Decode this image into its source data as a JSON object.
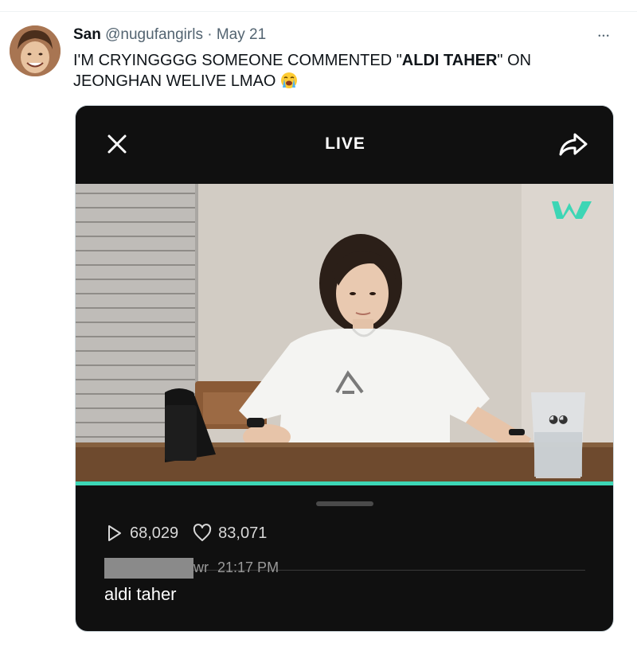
{
  "tweet": {
    "author_name": "San",
    "author_handle": "@nugufangirls",
    "separator": "·",
    "date": "May 21",
    "more_label": "•••",
    "text_part1": "I'M CRYINGGGG SOMEONE COMMENTED \"",
    "text_bold": "ALDI TAHER",
    "text_part2": "\" ON JEONGHAN WELIVE LMAO",
    "emoji_icon": "loudly-crying-face-icon"
  },
  "live_screen": {
    "title": "LIVE",
    "close_icon": "close-icon",
    "share_icon": "share-icon",
    "progress": 1.0,
    "accent_color": "#3dd6b5",
    "stats": {
      "plays": "68,029",
      "hearts": "83,071"
    },
    "comment": {
      "author_suffix": "wr",
      "time": "21:17 PM",
      "text": "aldi taher"
    }
  }
}
